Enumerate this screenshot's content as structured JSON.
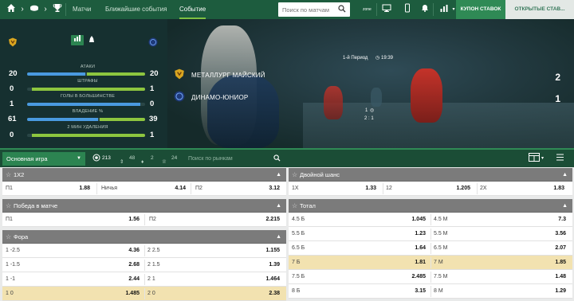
{
  "topnav": {
    "home_icon": "home-icon",
    "tabs": [
      "Матчи",
      "Ближайшие события",
      "Событие"
    ],
    "active_tab": "Событие",
    "search_placeholder": "Поиск по матчам",
    "zoom_label": "zone",
    "coupon_tabs": [
      "КУПОН СТАВОК",
      "ОТКРЫТЫЕ СТАВ..."
    ]
  },
  "match": {
    "home_team": "МЕТАЛЛУРГ МАЙСКИЙ",
    "away_team": "ДИНАМО-ЮНИОР",
    "period": "1-й Период",
    "time": "19:39",
    "home_score": "2",
    "away_score": "1",
    "mini_line1": "1",
    "mini_line2": "2 : 1"
  },
  "stats": [
    {
      "label": "АТАКИ",
      "home": "20",
      "away": "20",
      "home_share": 0.5
    },
    {
      "label": "ШТРАФЫ",
      "home": "0",
      "away": "1",
      "home_share": 0.0
    },
    {
      "label": "ГОЛЫ В БОЛЬШИНСТВЕ",
      "home": "1",
      "away": "0",
      "home_share": 1.0
    },
    {
      "label": "ВЛАДЕНИЕ %",
      "home": "61",
      "away": "39",
      "home_share": 0.61
    },
    {
      "label": "2 МИН УДАЛЕНИЯ",
      "home": "0",
      "away": "1",
      "home_share": 0.0
    }
  ],
  "filterbar": {
    "market_select": "Основная игра",
    "count_all": "213",
    "count_2": "48",
    "count_3": "2",
    "count_4": "24",
    "search_placeholder": "Поиск по рынкам"
  },
  "markets_left": [
    {
      "title": "1X2",
      "rows": [
        {
          "cells": [
            [
              "П1",
              "1.88"
            ],
            [
              "Ничья",
              "4.14"
            ],
            [
              "П2",
              "3.12"
            ]
          ],
          "highlight": false
        }
      ]
    },
    {
      "title": "Победа в матче",
      "rows": [
        {
          "cells": [
            [
              "П1",
              "1.56"
            ],
            [
              "П2",
              "2.215"
            ]
          ],
          "highlight": false
        }
      ]
    },
    {
      "title": "Фора",
      "rows": [
        {
          "cells": [
            [
              "1 -2.5",
              "4.36"
            ],
            [
              "2 2.5",
              "1.155"
            ]
          ],
          "highlight": false
        },
        {
          "cells": [
            [
              "1 -1.5",
              "2.68"
            ],
            [
              "2 1.5",
              "1.39"
            ]
          ],
          "highlight": false
        },
        {
          "cells": [
            [
              "1 -1",
              "2.44"
            ],
            [
              "2 1",
              "1.464"
            ]
          ],
          "highlight": false
        },
        {
          "cells": [
            [
              "1 0",
              "1.485"
            ],
            [
              "2 0",
              "2.38"
            ]
          ],
          "highlight": true
        }
      ]
    }
  ],
  "markets_right": [
    {
      "title": "Двойной шанс",
      "rows": [
        {
          "cells": [
            [
              "1X",
              "1.33"
            ],
            [
              "12",
              "1.205"
            ],
            [
              "2X",
              "1.83"
            ]
          ],
          "highlight": false
        }
      ]
    },
    {
      "title": "Тотал",
      "rows": [
        {
          "cells": [
            [
              "4.5 Б",
              "1.045"
            ],
            [
              "4.5 М",
              "7.3"
            ]
          ],
          "highlight": false
        },
        {
          "cells": [
            [
              "5.5 Б",
              "1.23"
            ],
            [
              "5.5 М",
              "3.56"
            ]
          ],
          "highlight": false
        },
        {
          "cells": [
            [
              "6.5 Б",
              "1.64"
            ],
            [
              "6.5 М",
              "2.07"
            ]
          ],
          "highlight": false
        },
        {
          "cells": [
            [
              "7 Б",
              "1.81"
            ],
            [
              "7 М",
              "1.85"
            ]
          ],
          "highlight": true
        },
        {
          "cells": [
            [
              "7.5 Б",
              "2.485"
            ],
            [
              "7.5 М",
              "1.48"
            ]
          ],
          "highlight": false
        },
        {
          "cells": [
            [
              "8 Б",
              "3.15"
            ],
            [
              "8 М",
              "1.29"
            ]
          ],
          "highlight": false
        }
      ]
    }
  ],
  "colors": {
    "nav_green": "#1d5c3e",
    "accent_green": "#8dc63f",
    "home_bar_blue": "#4a9ae0",
    "header_grey": "#7b7b7b",
    "highlight_row": "#f2e2b0"
  }
}
